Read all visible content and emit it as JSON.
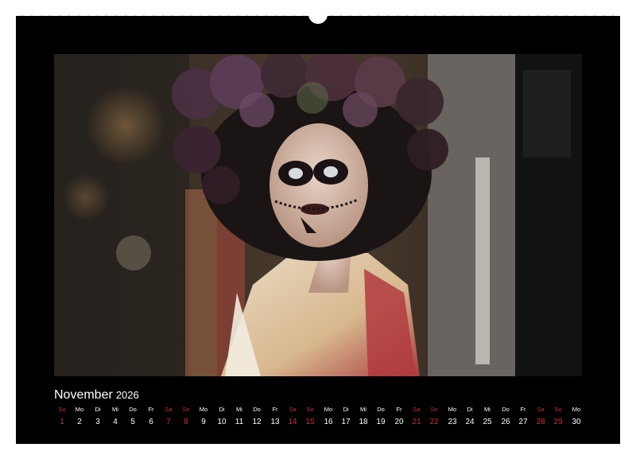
{
  "calendar": {
    "month": "November",
    "year": "2026",
    "days": [
      {
        "wd": "So",
        "d": "1",
        "w": true
      },
      {
        "wd": "Mo",
        "d": "2",
        "w": false
      },
      {
        "wd": "Di",
        "d": "3",
        "w": false
      },
      {
        "wd": "Mi",
        "d": "4",
        "w": false
      },
      {
        "wd": "Do",
        "d": "5",
        "w": false
      },
      {
        "wd": "Fr",
        "d": "6",
        "w": false
      },
      {
        "wd": "Sa",
        "d": "7",
        "w": true
      },
      {
        "wd": "So",
        "d": "8",
        "w": true
      },
      {
        "wd": "Mo",
        "d": "9",
        "w": false
      },
      {
        "wd": "Di",
        "d": "10",
        "w": false
      },
      {
        "wd": "Mi",
        "d": "11",
        "w": false
      },
      {
        "wd": "Do",
        "d": "12",
        "w": false
      },
      {
        "wd": "Fr",
        "d": "13",
        "w": false
      },
      {
        "wd": "Sa",
        "d": "14",
        "w": true
      },
      {
        "wd": "So",
        "d": "15",
        "w": true
      },
      {
        "wd": "Mo",
        "d": "16",
        "w": false
      },
      {
        "wd": "Di",
        "d": "17",
        "w": false
      },
      {
        "wd": "Mi",
        "d": "18",
        "w": false
      },
      {
        "wd": "Do",
        "d": "19",
        "w": false
      },
      {
        "wd": "Fr",
        "d": "20",
        "w": false
      },
      {
        "wd": "Sa",
        "d": "21",
        "w": true
      },
      {
        "wd": "So",
        "d": "22",
        "w": true
      },
      {
        "wd": "Mo",
        "d": "23",
        "w": false
      },
      {
        "wd": "Di",
        "d": "24",
        "w": false
      },
      {
        "wd": "Mi",
        "d": "25",
        "w": false
      },
      {
        "wd": "Do",
        "d": "26",
        "w": false
      },
      {
        "wd": "Fr",
        "d": "27",
        "w": false
      },
      {
        "wd": "Sa",
        "d": "28",
        "w": true
      },
      {
        "wd": "So",
        "d": "29",
        "w": true
      },
      {
        "wd": "Mo",
        "d": "30",
        "w": false
      }
    ]
  },
  "colors": {
    "sheet": "#000000",
    "weekday_text": "#ffffff",
    "weekend_text": "#c8302e"
  }
}
